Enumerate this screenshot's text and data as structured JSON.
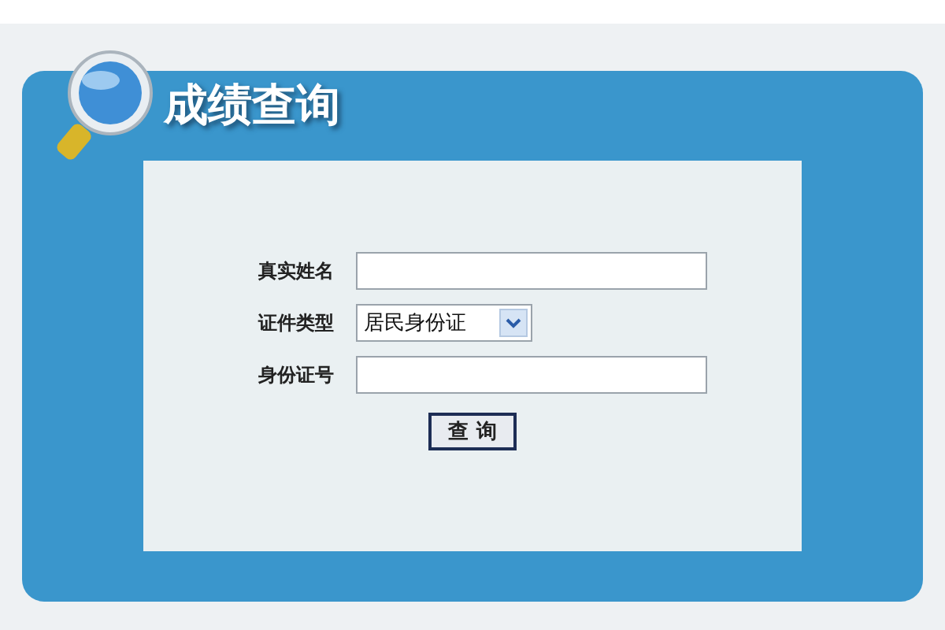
{
  "header": {
    "title": "成绩查询"
  },
  "form": {
    "fields": [
      {
        "kind": "text",
        "label": "真实姓名"
      },
      {
        "kind": "select",
        "label": "证件类型",
        "value": "居民身份证"
      },
      {
        "kind": "text",
        "label": "身份证号"
      }
    ],
    "submit": "查 询"
  }
}
